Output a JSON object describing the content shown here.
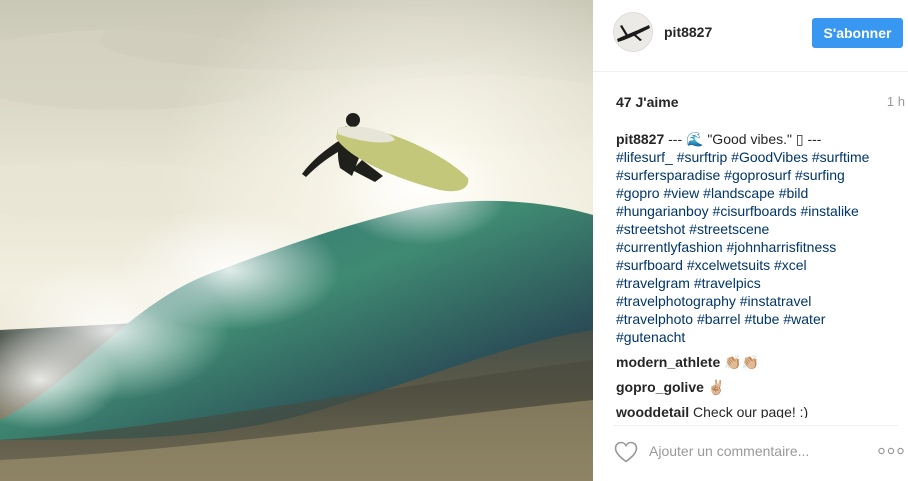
{
  "post": {
    "username": "pit8827",
    "follow_label": "S'abonner",
    "likes": "47 J'aime",
    "time": "1 h"
  },
  "caption": {
    "username": "pit8827",
    "text_start": "--- 🌊 \"Good vibes.\" ▯ ---",
    "hashtags": [
      "#lifesurf_",
      "#surftrip",
      "#GoodVibes",
      "#surftime",
      "#surfersparadise",
      "#goprosurf",
      "#surfing",
      "#gopro",
      "#view",
      "#landscape",
      "#bild",
      "#hungarianboy",
      "#cisurfboards",
      "#instalike",
      "#streetshot",
      "#streetscene",
      "#currentlyfashion",
      "#johnharrisfitness",
      "#surfboard",
      "#xcelwetsuits",
      "#xcel",
      "#travelgram",
      "#travelpics",
      "#travelphotography",
      "#instatravel",
      "#travelphoto",
      "#barrel",
      "#tube",
      "#water",
      "#gutenacht"
    ]
  },
  "comments": [
    {
      "username": "modern_athlete",
      "text": "👏🏼👏🏼"
    },
    {
      "username": "gopro_golive",
      "text": "✌🏼"
    },
    {
      "username": "wooddetail",
      "text": "Check our page! :)"
    }
  ],
  "add_comment": {
    "placeholder": "Ajouter un commentaire..."
  },
  "icons": {
    "like": "heart-icon",
    "more": "more-options-icon"
  },
  "colors": {
    "follow_button": "#3897f0",
    "hashtag": "#003569",
    "muted": "#999999"
  }
}
